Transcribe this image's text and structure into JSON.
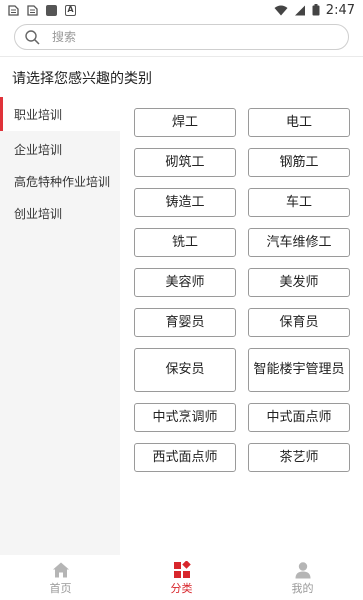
{
  "status_bar": {
    "time": "2:47",
    "left_icons": [
      "sim-icon",
      "sim-icon",
      "square-icon",
      "a-icon"
    ],
    "right_icons": [
      "wifi-icon",
      "signal-icon",
      "battery-icon"
    ]
  },
  "search": {
    "placeholder": "搜索"
  },
  "prompt": {
    "title": "请选择您感兴趣的类别"
  },
  "sidebar": {
    "items": [
      {
        "label": "职业培训",
        "active": true
      },
      {
        "label": "企业培训",
        "active": false
      },
      {
        "label": "高危特种作业培训",
        "active": false
      },
      {
        "label": "创业培训",
        "active": false
      }
    ]
  },
  "categories": [
    "焊工",
    "电工",
    "砌筑工",
    "钢筋工",
    "铸造工",
    "车工",
    "铣工",
    "汽车维修工",
    "美容师",
    "美发师",
    "育婴员",
    "保育员",
    "保安员",
    "智能楼宇管理员",
    "中式烹调师",
    "中式面点师",
    "西式面点师",
    "茶艺师"
  ],
  "bottom_nav": {
    "items": [
      {
        "label": "首页",
        "icon": "home-icon",
        "active": false
      },
      {
        "label": "分类",
        "icon": "category-icon",
        "active": true
      },
      {
        "label": "我的",
        "icon": "profile-icon",
        "active": false
      }
    ]
  },
  "colors": {
    "accent": "#d8262c",
    "sidebar_bg": "#f5f5f5",
    "inactive_nav": "#999999"
  }
}
